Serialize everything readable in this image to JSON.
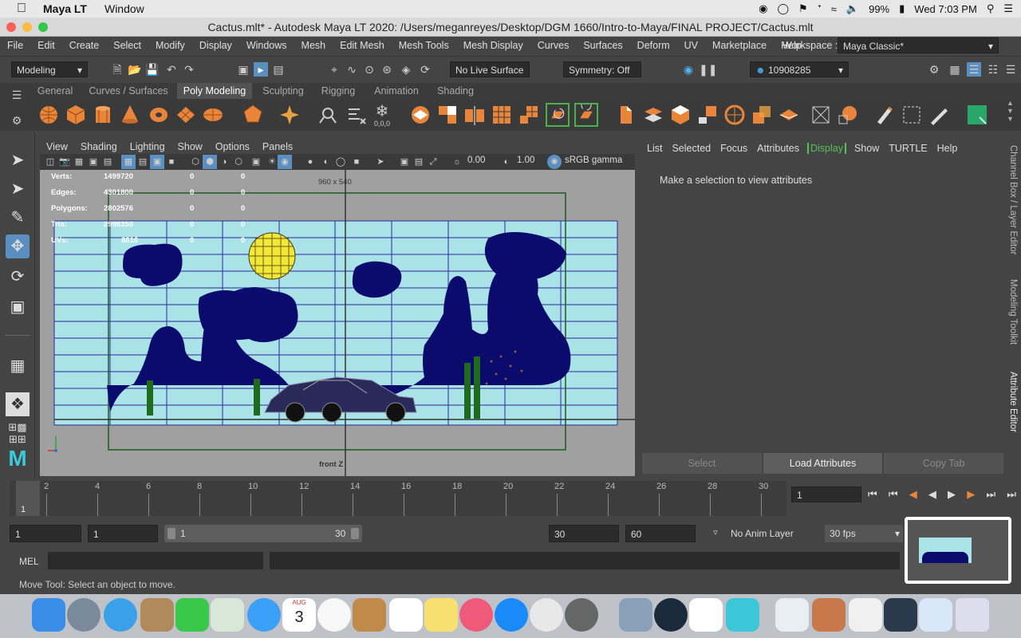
{
  "mac_menubar": {
    "app_name": "Maya LT",
    "menu": "Window",
    "battery": "99%",
    "clock": "Wed 7:03 PM"
  },
  "window": {
    "title": "Cactus.mlt* - Autodesk Maya LT 2020: /Users/meganreyes/Desktop/DGM 1660/Intro-to-Maya/FINAL PROJECT/Cactus.mlt"
  },
  "maya_menu": [
    "File",
    "Edit",
    "Create",
    "Select",
    "Modify",
    "Display",
    "Windows",
    "Mesh",
    "Edit Mesh",
    "Mesh Tools",
    "Mesh Display",
    "Curves",
    "Surfaces",
    "Deform",
    "UV",
    "Marketplace",
    "Help"
  ],
  "workspace": {
    "label": "Workspace :",
    "value": "Maya Classic*"
  },
  "status_line": {
    "mode": "Modeling",
    "live_surface": "No Live Surface",
    "symmetry": "Symmetry: Off",
    "user_id": "10908285"
  },
  "shelf_tabs": [
    "General",
    "Curves / Surfaces",
    "Poly Modeling",
    "Sculpting",
    "Rigging",
    "Animation",
    "Shading"
  ],
  "shelf_active": "Poly Modeling",
  "viewport": {
    "menu": [
      "View",
      "Shading",
      "Lighting",
      "Show",
      "Options",
      "Panels"
    ],
    "exposure": "0.00",
    "gamma": "1.00",
    "color_space": "sRGB gamma",
    "resolution": "960 x 540",
    "camera": "front Z",
    "hud": [
      {
        "label": "Verts:",
        "v1": "1499720",
        "v2": "0",
        "v3": "0"
      },
      {
        "label": "Edges:",
        "v1": "4301800",
        "v2": "0",
        "v3": "0"
      },
      {
        "label": "Polygons:",
        "v1": "2802576",
        "v2": "0",
        "v3": "0"
      },
      {
        "label": "Tris:",
        "v1": "2998350",
        "v2": "0",
        "v3": "0"
      },
      {
        "label": "UVs:",
        "v1": "8816",
        "v2": "0",
        "v3": "0"
      }
    ]
  },
  "channel_box": {
    "menu": [
      "List",
      "Selected",
      "Focus",
      "Attributes",
      "Display",
      "Show",
      "TURTLE",
      "Help"
    ],
    "message": "Make a selection to view attributes",
    "buttons": [
      "Select",
      "Load Attributes",
      "Copy Tab"
    ]
  },
  "side_tabs": [
    "Channel Box / Layer Editor",
    "Modeling Toolkit",
    "Attribute Editor"
  ],
  "timeline": {
    "ticks": [
      "2",
      "4",
      "6",
      "8",
      "10",
      "12",
      "14",
      "16",
      "18",
      "20",
      "22",
      "24",
      "26",
      "28",
      "30"
    ],
    "current": "1",
    "frame_field": "1"
  },
  "range": {
    "start": "1",
    "playback_start": "1",
    "range_start": "1",
    "range_end": "30",
    "playback_end": "30",
    "end": "60",
    "anim_layer": "No Anim Layer",
    "fps": "30 fps"
  },
  "command": {
    "label": "MEL"
  },
  "help_line": "Move Tool: Select an object to move.",
  "dock_date": {
    "month": "AUG",
    "day": "3"
  }
}
